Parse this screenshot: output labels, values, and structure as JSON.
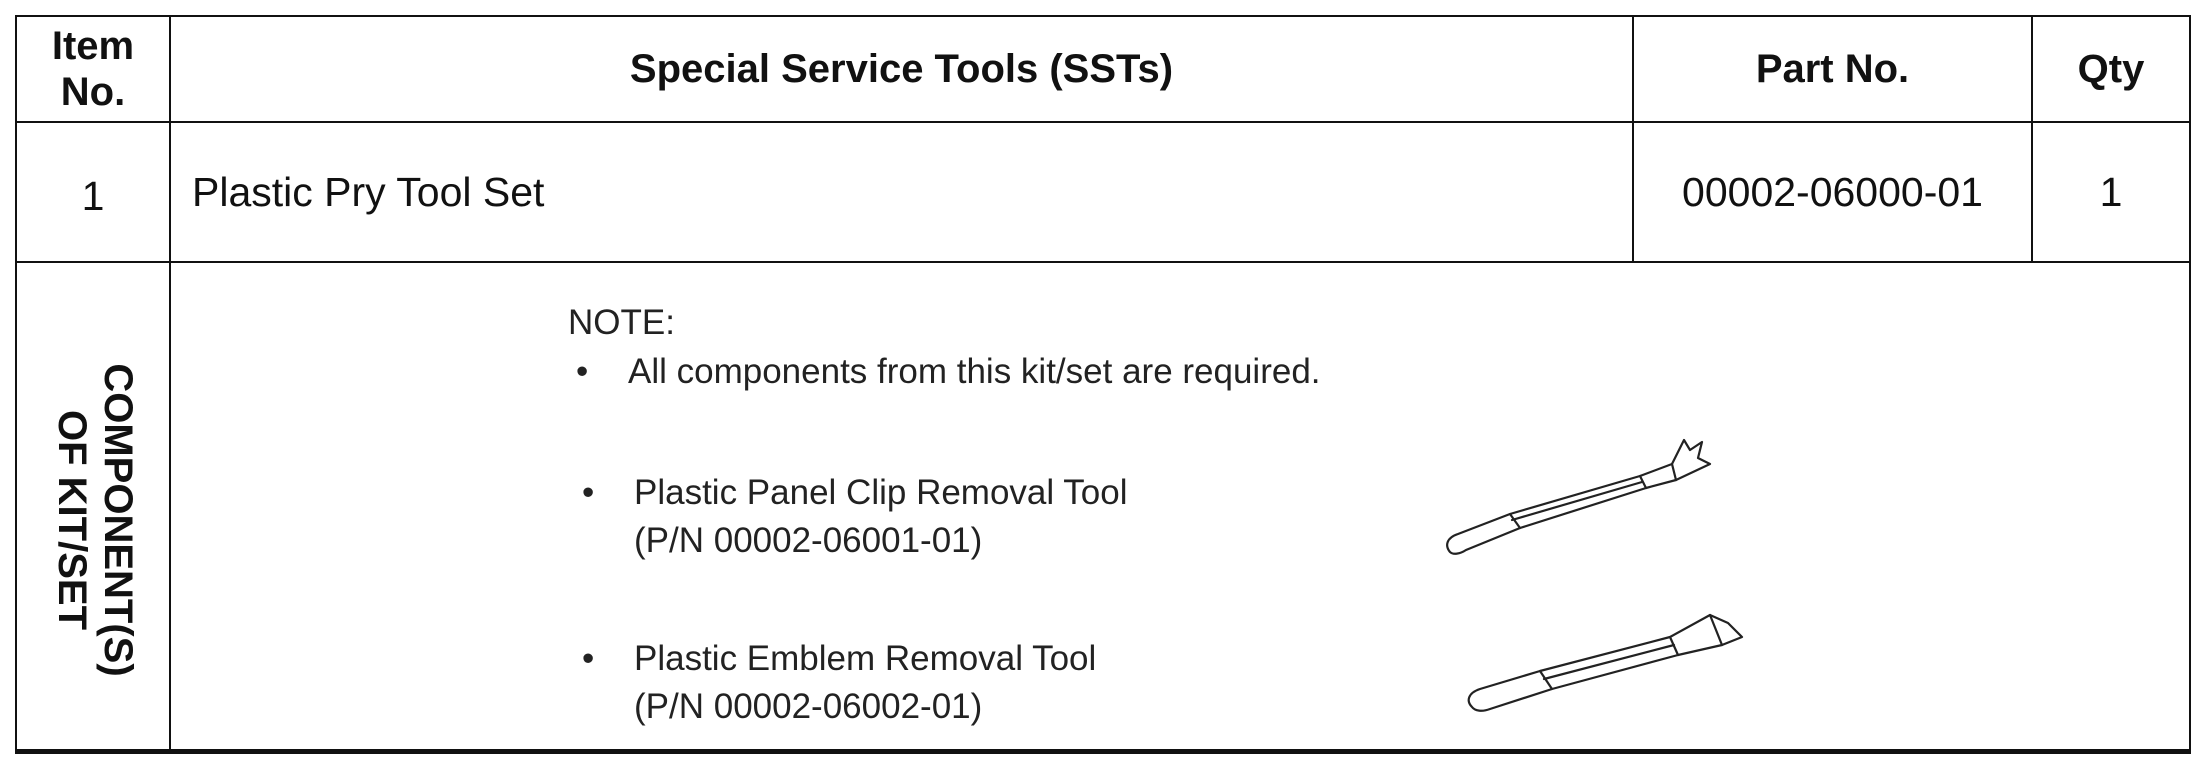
{
  "header": {
    "item_no": "Item No.",
    "item_no_line1": "Item",
    "item_no_line2": "No.",
    "sst": "Special Service Tools (SSTs)",
    "part_no": "Part No.",
    "qty": "Qty"
  },
  "row": {
    "item": "1",
    "name": "Plastic Pry Tool Set",
    "part_no": "00002-06000-01",
    "qty": "1"
  },
  "components": {
    "side_label_line1": "COMPONENT(S)",
    "side_label_line2": "OF KIT/SET",
    "note_title": "NOTE:",
    "note_bullet": "All components from this kit/set are required.",
    "items": [
      {
        "name": "Plastic Panel Clip Removal Tool",
        "part": "(P/N 00002-06001-01)",
        "icon": "panel-clip-removal-tool-icon"
      },
      {
        "name": "Plastic Emblem Removal Tool",
        "part": "(P/N 00002-06002-01)",
        "icon": "emblem-removal-tool-icon"
      }
    ]
  }
}
